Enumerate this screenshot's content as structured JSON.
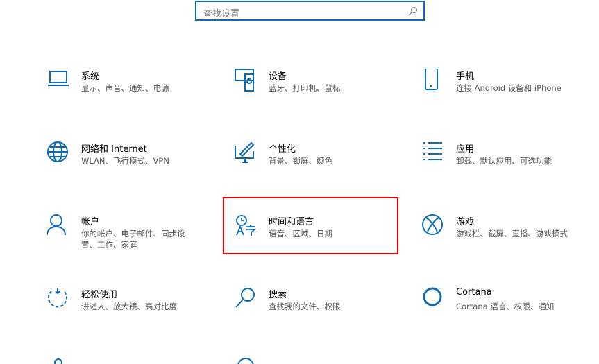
{
  "search": {
    "placeholder": "查找设置",
    "icon": "search-icon"
  },
  "tiles": [
    {
      "title": "系统",
      "subtitle": "显示、声音、通知、电源"
    },
    {
      "title": "设备",
      "subtitle": "蓝牙、打印机、鼠标"
    },
    {
      "title": "手机",
      "subtitle": "连接 Android 设备和 iPhone"
    },
    {
      "title": "网络和 Internet",
      "subtitle": "WLAN、飞行模式、VPN"
    },
    {
      "title": "个性化",
      "subtitle": "背景、锁屏、颜色"
    },
    {
      "title": "应用",
      "subtitle": "卸载、默认应用、可选功能"
    },
    {
      "title": "帐户",
      "subtitle": "你的帐户、电子邮件、同步设置、工作、家庭"
    },
    {
      "title": "时间和语言",
      "subtitle": "语音、区域、日期"
    },
    {
      "title": "游戏",
      "subtitle": "游戏栏、截屏、直播、游戏模式"
    },
    {
      "title": "轻松使用",
      "subtitle": "讲述人、放大镜、高对比度"
    },
    {
      "title": "搜索",
      "subtitle": "查找我的文件、权限"
    },
    {
      "title": "Cortana",
      "subtitle": "Cortana 语言、权限、通知"
    }
  ],
  "accent": "#0b6bb5",
  "highlight": "#e00000"
}
